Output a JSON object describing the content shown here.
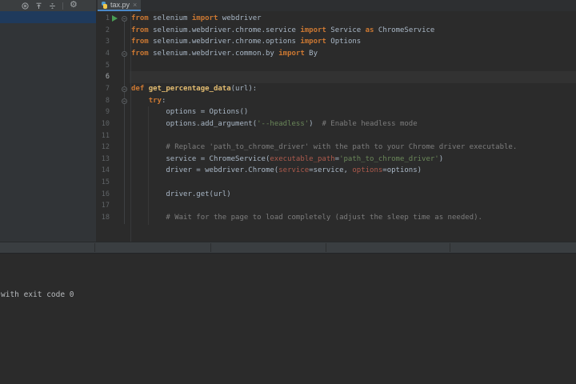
{
  "toolbar": {
    "icons": [
      "stop-icon",
      "scroll-to-top-icon",
      "collapse-icon",
      "settings-gear-icon",
      "hide-icon"
    ],
    "gear_glyph": "⚙"
  },
  "tabs": {
    "active_label": "tax.py",
    "close_glyph": "×"
  },
  "editor": {
    "current_line": 6,
    "lines": [
      {
        "n": 1,
        "run": true,
        "fold": true,
        "t": [
          [
            "kw",
            "from"
          ],
          [
            "pl",
            " selenium "
          ],
          [
            "kw",
            "import"
          ],
          [
            "pl",
            " webdriver"
          ]
        ]
      },
      {
        "n": 2,
        "t": [
          [
            "kw",
            "from"
          ],
          [
            "pl",
            " selenium.webdriver.chrome.service "
          ],
          [
            "kw",
            "import"
          ],
          [
            "pl",
            " Service "
          ],
          [
            "kw",
            "as"
          ],
          [
            "pl",
            " ChromeService"
          ]
        ]
      },
      {
        "n": 3,
        "t": [
          [
            "kw",
            "from"
          ],
          [
            "pl",
            " selenium.webdriver.chrome.options "
          ],
          [
            "kw",
            "import"
          ],
          [
            "pl",
            " Options"
          ]
        ]
      },
      {
        "n": 4,
        "fold": true,
        "t": [
          [
            "kw",
            "from"
          ],
          [
            "pl",
            " selenium.webdriver.common.by "
          ],
          [
            "kw",
            "import"
          ],
          [
            "pl",
            " By"
          ]
        ]
      },
      {
        "n": 5,
        "t": []
      },
      {
        "n": 6,
        "t": []
      },
      {
        "n": 7,
        "fold": true,
        "t": [
          [
            "kw",
            "def"
          ],
          [
            "pl",
            " "
          ],
          [
            "fn",
            "get_percentage_data"
          ],
          [
            "pl",
            "(url):"
          ]
        ]
      },
      {
        "n": 8,
        "fold": true,
        "t": [
          [
            "pl",
            "    "
          ],
          [
            "kw",
            "try"
          ],
          [
            "pl",
            ":"
          ]
        ]
      },
      {
        "n": 9,
        "t": [
          [
            "pl",
            "        options = Options()"
          ]
        ]
      },
      {
        "n": 10,
        "t": [
          [
            "pl",
            "        options.add_argument("
          ],
          [
            "str",
            "'--headless'"
          ],
          [
            "pl",
            ")  "
          ],
          [
            "cm",
            "# Enable headless mode"
          ]
        ]
      },
      {
        "n": 11,
        "t": []
      },
      {
        "n": 12,
        "t": [
          [
            "pl",
            "        "
          ],
          [
            "cm",
            "# Replace 'path_to_chrome_driver' with the path to your Chrome driver executable."
          ]
        ]
      },
      {
        "n": 13,
        "t": [
          [
            "pl",
            "        service = ChromeService("
          ],
          [
            "arg",
            "executable_path"
          ],
          [
            "pl",
            "="
          ],
          [
            "str",
            "'path_to_chrome_driver'"
          ],
          [
            "pl",
            ")"
          ]
        ]
      },
      {
        "n": 14,
        "t": [
          [
            "pl",
            "        driver = webdriver.Chrome("
          ],
          [
            "arg",
            "service"
          ],
          [
            "pl",
            "=service, "
          ],
          [
            "arg",
            "options"
          ],
          [
            "pl",
            "=options)"
          ]
        ]
      },
      {
        "n": 15,
        "t": []
      },
      {
        "n": 16,
        "t": [
          [
            "pl",
            "        driver.get(url)"
          ]
        ]
      },
      {
        "n": 17,
        "t": []
      },
      {
        "n": 18,
        "t": [
          [
            "pl",
            "        "
          ],
          [
            "cm",
            "# Wait for the page to load completely (adjust the sleep time as needed)."
          ]
        ]
      }
    ]
  },
  "console": {
    "text": "with exit code 0"
  },
  "colors": {
    "accent_blue": "#4a88c7",
    "keyword": "#cc7832",
    "string": "#6a8759",
    "comment": "#7d7d7d",
    "code_text": "#a9b7c6",
    "function_name": "#e3bc70",
    "named_argument": "#ad5a4c",
    "run_green": "#499c54",
    "selection_navy": "#1f3a5c",
    "editor_bg": "#2b2b2b",
    "panel_bg": "#313437",
    "toolbar_bg": "#3b3e40"
  }
}
